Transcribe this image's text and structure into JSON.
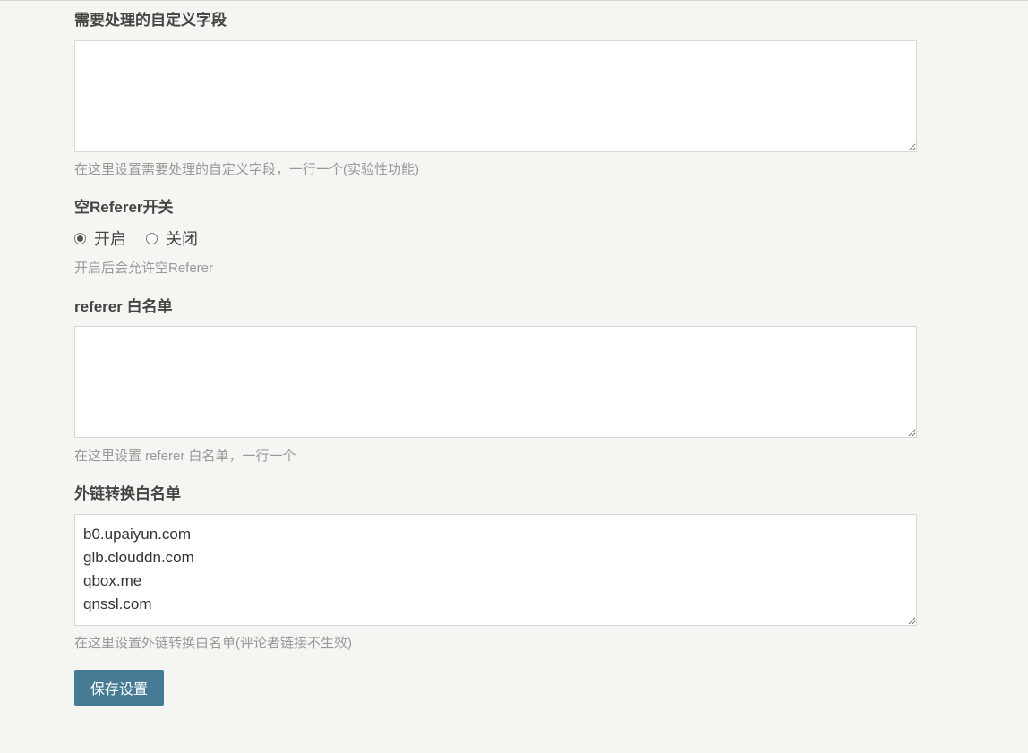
{
  "custom_fields": {
    "label": "需要处理的自定义字段",
    "value": "",
    "description": "在这里设置需要处理的自定义字段，一行一个(实验性功能)"
  },
  "empty_referer": {
    "label": "空Referer开关",
    "options": [
      {
        "label": "开启",
        "checked": true
      },
      {
        "label": "关闭",
        "checked": false
      }
    ],
    "description": "开启后会允许空Referer"
  },
  "referer_whitelist": {
    "label": "referer 白名单",
    "value": "",
    "description": "在这里设置 referer 白名单，一行一个"
  },
  "external_link_whitelist": {
    "label": "外链转换白名单",
    "value": "b0.upaiyun.com\nglb.clouddn.com\nqbox.me\nqnssl.com",
    "description": "在这里设置外链转换白名单(评论者链接不生效)"
  },
  "save_button": {
    "label": "保存设置",
    "color": "#467b96"
  }
}
